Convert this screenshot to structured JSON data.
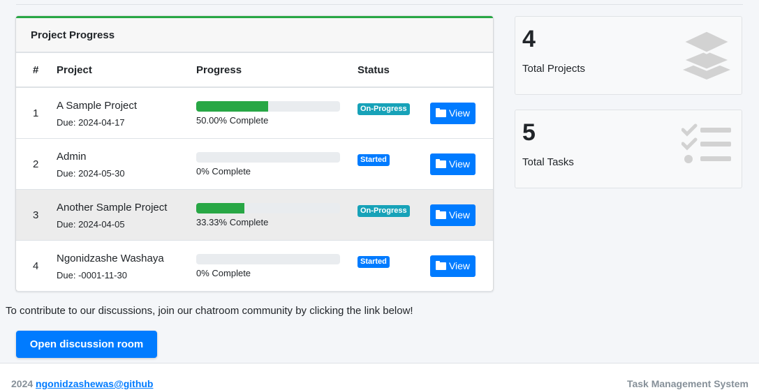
{
  "card": {
    "title": "Project Progress",
    "accent_color": "#28a745",
    "columns": [
      "#",
      "Project",
      "Progress",
      "Status"
    ],
    "rows": [
      {
        "num": "1",
        "name": "A Sample Project",
        "due": "Due: 2024-04-17",
        "progress": 50.0,
        "progress_text": "50.00% Complete",
        "status": "On-Progress",
        "status_color": "#17a2b8",
        "action": "View"
      },
      {
        "num": "2",
        "name": "Admin",
        "due": "Due: 2024-05-30",
        "progress": 0,
        "progress_text": "0% Complete",
        "status": "Started",
        "status_color": "#007bff",
        "action": "View"
      },
      {
        "num": "3",
        "name": "Another Sample Project",
        "due": "Due: 2024-04-05",
        "progress": 33.33,
        "progress_text": "33.33% Complete",
        "status": "On-Progress",
        "status_color": "#17a2b8",
        "action": "View"
      },
      {
        "num": "4",
        "name": "Ngonidzashe Washaya",
        "due": "Due: -0001-11-30",
        "progress": 0,
        "progress_text": "0% Complete",
        "status": "Started",
        "status_color": "#007bff",
        "action": "View"
      }
    ]
  },
  "stats": {
    "projects": {
      "value": "4",
      "label": "Total Projects",
      "icon": "layers-icon"
    },
    "tasks": {
      "value": "5",
      "label": "Total Tasks",
      "icon": "tasks-list-icon"
    }
  },
  "contrib_text": "To contribute to our discussions, join our chatroom community by clicking the link below!",
  "discuss_button": "Open discussion room",
  "footer": {
    "year": "2024",
    "link_text": "ngonidzashewas@github",
    "app_name": "Task Management System"
  }
}
